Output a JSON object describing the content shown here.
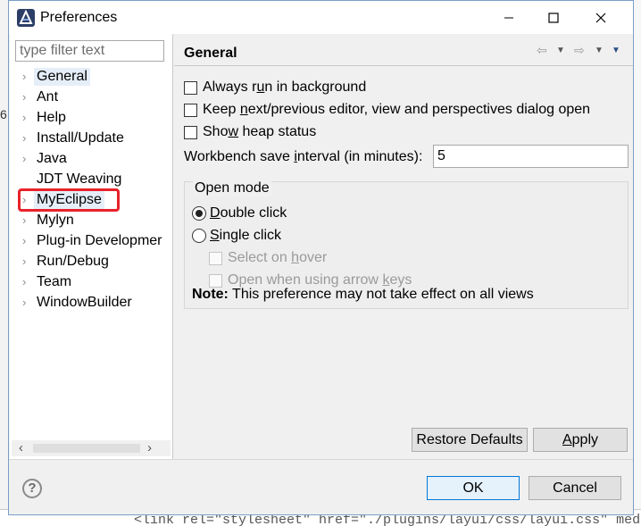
{
  "window": {
    "title": "Preferences",
    "controls": {
      "minimize": "minimize-icon",
      "maximize": "maximize-icon",
      "close": "close-icon"
    }
  },
  "filter": {
    "placeholder": "type filter text",
    "value": ""
  },
  "tree": {
    "items": [
      {
        "label": "General",
        "expandable": true,
        "selected": true
      },
      {
        "label": "Ant",
        "expandable": true
      },
      {
        "label": "Help",
        "expandable": true
      },
      {
        "label": "Install/Update",
        "expandable": true
      },
      {
        "label": "Java",
        "expandable": true
      },
      {
        "label": "JDT Weaving",
        "expandable": false
      },
      {
        "label": "MyEclipse",
        "expandable": true,
        "highlighted": true,
        "highlight_color": "#e8222a"
      },
      {
        "label": "Mylyn",
        "expandable": true
      },
      {
        "label": "Plug-in Developmer",
        "expandable": true
      },
      {
        "label": "Run/Debug",
        "expandable": true
      },
      {
        "label": "Team",
        "expandable": true
      },
      {
        "label": "WindowBuilder",
        "expandable": true
      }
    ]
  },
  "page": {
    "title": "General",
    "always_run_before": "Always r",
    "always_run_mnemonic": "u",
    "always_run_after": "n in background",
    "keep_next_before": "Keep ",
    "keep_next_mnemonic": "n",
    "keep_next_after": "ext/previous editor, view and perspectives dialog open",
    "show_heap_before": "Sho",
    "show_heap_mnemonic": "w",
    "show_heap_after": " heap status",
    "interval_before": "Workbench save ",
    "interval_mnemonic": "i",
    "interval_after": "nterval (in minutes):",
    "interval_value": "5",
    "open_mode": {
      "legend": "Open mode",
      "double_mnemonic": "D",
      "double_after": "ouble click",
      "single_mnemonic": "S",
      "single_after": "ingle click",
      "select_hover_before": "Select on ",
      "select_hover_mnemonic": "h",
      "select_hover_after": "over",
      "arrow_keys_before": "Open when using arrow ",
      "arrow_keys_mnemonic": "k",
      "arrow_keys_after": "eys",
      "note_bold": "Note:",
      "note_text": " This preference may not take effect on all views"
    },
    "restore_defaults": "Restore Defaults",
    "apply_mnemonic": "A",
    "apply_after": "pply"
  },
  "footer": {
    "ok": "OK",
    "cancel": "Cancel"
  },
  "background": {
    "left_gutter": "6",
    "bottom_code": "<link rel=\"stylesheet\" href=\"./plugins/layui/css/layui.css\" med"
  },
  "colors": {
    "accent": "#0078d7",
    "highlight": "#e8222a",
    "selection": "#e5eef8"
  }
}
